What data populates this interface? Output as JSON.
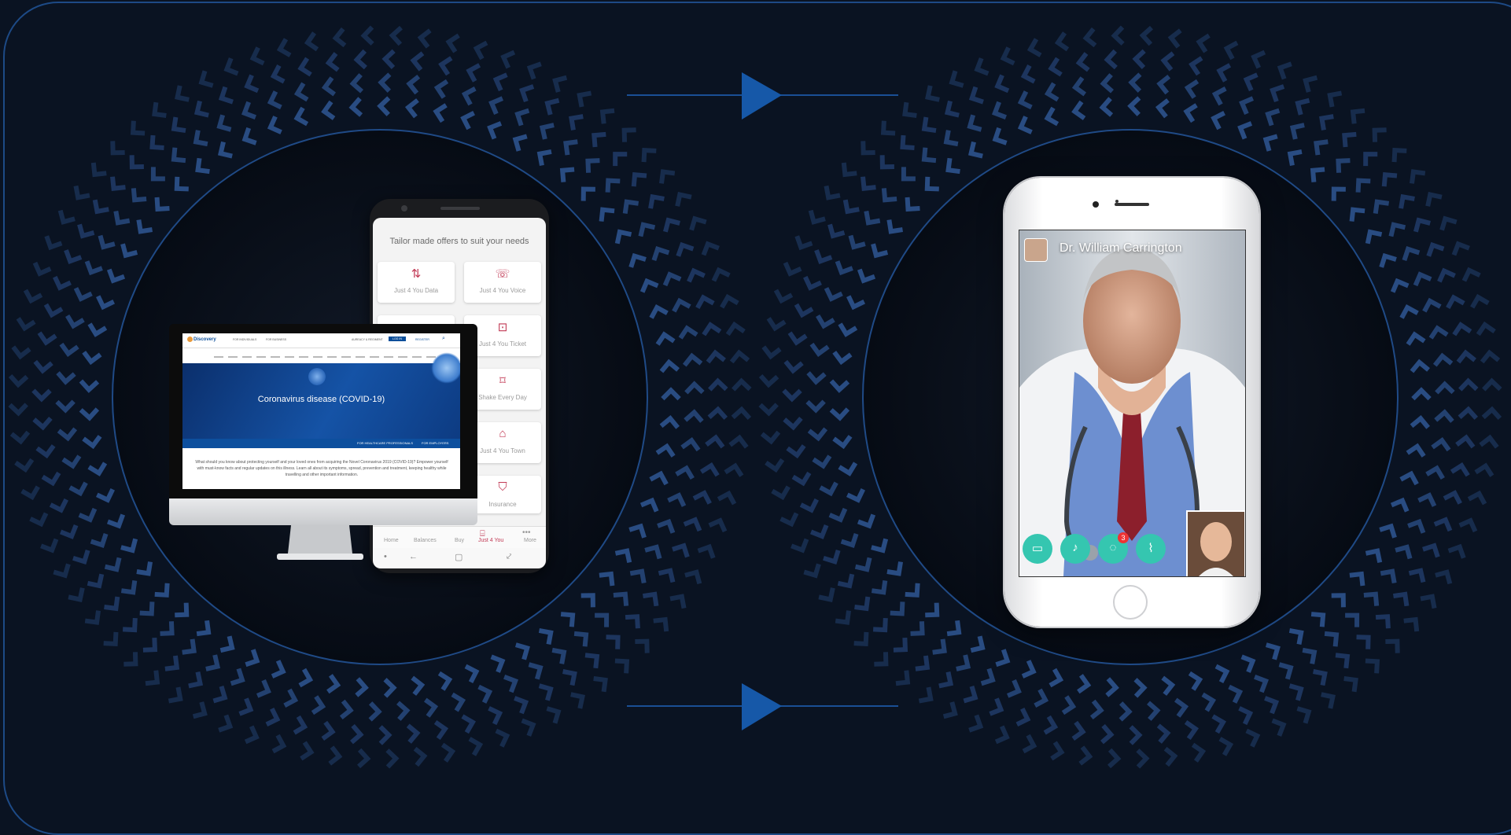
{
  "phone_offers": {
    "title": "Tailor made offers to suit your needs",
    "tiles": [
      {
        "label": "Just 4 You Data",
        "icon": "data-icon"
      },
      {
        "label": "Just 4 You Voice",
        "icon": "phone-icon"
      },
      {
        "label": "",
        "icon": "tag-icon"
      },
      {
        "label": "Just 4 You Ticket",
        "icon": "ticket-icon"
      },
      {
        "label": "Shake Every Day",
        "icon": "shake-icon"
      },
      {
        "label": "Just 4 You Town",
        "icon": "home-icon"
      },
      {
        "label": "Insurance",
        "icon": "shield-icon"
      }
    ],
    "nav": [
      "Home",
      "Balances",
      "Buy",
      "Just 4 You",
      "More"
    ]
  },
  "website": {
    "logo": "Discovery",
    "nav_links": [
      "FOR INDIVIDUALS",
      "FOR BUSINESS"
    ],
    "header_right": [
      "AUREACY & REGIMENT",
      "LOG IN",
      "REGISTER"
    ],
    "hero_title": "Coronavirus disease (COVID-19)",
    "hero_links": [
      "FOR HEALTHCARE PROFESSIONALS",
      "FOR EMPLOYERS"
    ],
    "body_text": "What should you know about protecting yourself and your loved ones from acquiring the Novel Coronavirus 2019 (COVID-19)? Empower yourself with must-know facts and regular updates on this illness. Learn all about its symptoms, spread, prevention and treatment, keeping healthy while travelling and other important information."
  },
  "video_call": {
    "caller_name": "Dr. William Carrington",
    "chat_badge": "3",
    "controls": [
      "video-icon",
      "microphone-icon",
      "chat-icon",
      "attach-icon"
    ]
  },
  "colors": {
    "background": "#0a1322",
    "pattern": "#2b4f88",
    "arrow": "#1658a8",
    "accent_teal": "#35c6b0",
    "offer_red": "#c23a55"
  }
}
